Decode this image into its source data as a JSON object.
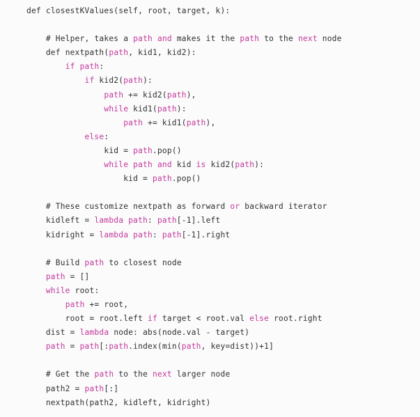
{
  "document": {
    "type": "source-code",
    "language": "python",
    "background_color": "#fbfbfb",
    "text_color": "#2e3033",
    "keyword_color": "#c2389c",
    "highlighted_tokens": [
      "path",
      "while",
      "if",
      "else",
      "and",
      "or",
      "next",
      "lambda",
      "is",
      "def"
    ],
    "lines": [
      {
        "indent": 0,
        "text": "def closestKValues(self, root, target, k):"
      },
      {
        "indent": 0,
        "text": ""
      },
      {
        "indent": 1,
        "text": "# Helper, takes a path and makes it the path to the next node"
      },
      {
        "indent": 1,
        "text": "def nextpath(path, kid1, kid2):"
      },
      {
        "indent": 2,
        "text": "if path:"
      },
      {
        "indent": 3,
        "text": "if kid2(path):"
      },
      {
        "indent": 4,
        "text": "path += kid2(path),"
      },
      {
        "indent": 4,
        "text": "while kid1(path):"
      },
      {
        "indent": 5,
        "text": "path += kid1(path),"
      },
      {
        "indent": 3,
        "text": "else:"
      },
      {
        "indent": 4,
        "text": "kid = path.pop()"
      },
      {
        "indent": 4,
        "text": "while path and kid is kid2(path):"
      },
      {
        "indent": 5,
        "text": "kid = path.pop()"
      },
      {
        "indent": 0,
        "text": ""
      },
      {
        "indent": 1,
        "text": "# These customize nextpath as forward or backward iterator"
      },
      {
        "indent": 1,
        "text": "kidleft = lambda path: path[-1].left"
      },
      {
        "indent": 1,
        "text": "kidright = lambda path: path[-1].right"
      },
      {
        "indent": 0,
        "text": ""
      },
      {
        "indent": 1,
        "text": "# Build path to closest node"
      },
      {
        "indent": 1,
        "text": "path = []"
      },
      {
        "indent": 1,
        "text": "while root:"
      },
      {
        "indent": 2,
        "text": "path += root,"
      },
      {
        "indent": 2,
        "text": "root = root.left if target < root.val else root.right"
      },
      {
        "indent": 1,
        "text": "dist = lambda node: abs(node.val - target)"
      },
      {
        "indent": 1,
        "text": "path = path[:path.index(min(path, key=dist))+1]"
      },
      {
        "indent": 0,
        "text": ""
      },
      {
        "indent": 1,
        "text": "# Get the path to the next larger node"
      },
      {
        "indent": 1,
        "text": "path2 = path[:]"
      },
      {
        "indent": 1,
        "text": "nextpath(path2, kidleft, kidright)"
      }
    ]
  }
}
